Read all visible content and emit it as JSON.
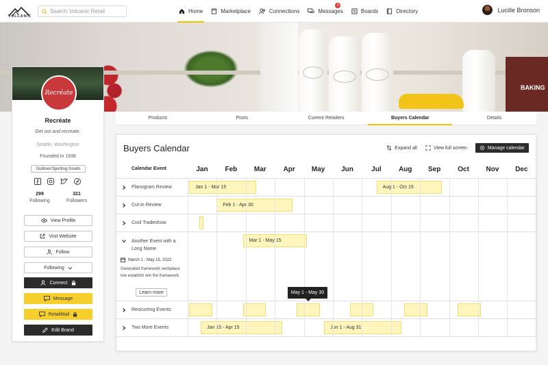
{
  "topnav": {
    "logo_text": "VOLCANIC",
    "search_placeholder": "Search Volcanic Retail",
    "items": [
      {
        "label": "Home",
        "icon": "home-icon",
        "active": true
      },
      {
        "label": "Marketplace",
        "icon": "store-icon",
        "active": false
      },
      {
        "label": "Connections",
        "icon": "people-icon",
        "active": false
      },
      {
        "label": "Messages",
        "icon": "chat-icon",
        "active": false,
        "badge": "5"
      },
      {
        "label": "Boards",
        "icon": "board-icon",
        "active": false
      },
      {
        "label": "Directory",
        "icon": "book-icon",
        "active": false
      }
    ],
    "user_name": "Lucille Bronson"
  },
  "hero": {
    "box_text": "BAKING"
  },
  "profile": {
    "logo_text": "Recréate",
    "name": "Recréate",
    "tagline": "Get out and recreate.",
    "location": "Seattle, Washington",
    "founded": "Founded in 1938",
    "category": "Outdoor/Sporting Goods",
    "socials": [
      "facebook-icon",
      "instagram-icon",
      "twitter-icon",
      "pinterest-icon"
    ],
    "following_count": "299",
    "following_label": "Following",
    "followers_count": "321",
    "followers_label": "Followers",
    "buttons": {
      "view_profile": "View Profile",
      "visit_website": "Visit Website",
      "follow": "Follow",
      "following": "Following",
      "connect": "Connect",
      "message": "Message",
      "retailmail": "RetailMail",
      "edit_brand": "Edit Brand"
    }
  },
  "tabs": [
    {
      "label": "Products",
      "active": false
    },
    {
      "label": "Posts",
      "active": false
    },
    {
      "label": "Current Retailers",
      "active": false
    },
    {
      "label": "Buyers Calendar",
      "active": true
    },
    {
      "label": "Details",
      "active": false
    }
  ],
  "calendar": {
    "title": "Buyers Calendar",
    "expand_all": "Expand all",
    "view_full_screen": "View full screen",
    "manage_calendar": "Manage calendar",
    "column_label": "Calendar Event",
    "months": [
      "Jan",
      "Feb",
      "Mar",
      "Apr",
      "May",
      "Jun",
      "Jul",
      "Aug",
      "Sep",
      "Oct",
      "Nov",
      "Dec"
    ],
    "rows": [
      {
        "name": "Planogram Review",
        "expanded": false,
        "bars": [
          {
            "start": 0.05,
            "end": 2.35,
            "label": "Jan 1 - Mar 15"
          },
          {
            "start": 6.5,
            "end": 8.75,
            "label": "Aug 1 - Oct 15"
          }
        ]
      },
      {
        "name": "Cut-in Review",
        "expanded": false,
        "bars": [
          {
            "start": 1.0,
            "end": 3.6,
            "label": "Feb 1 - Apr 30"
          }
        ]
      },
      {
        "name": "Cool Tradeshow",
        "expanded": false,
        "bars": [
          {
            "start": 0.4,
            "end": 0.55,
            "label": ""
          }
        ]
      },
      {
        "name": "Another Event with a Long Name",
        "expanded": true,
        "bars": [
          {
            "start": 1.9,
            "end": 4.1,
            "label": "Mar 1 - May 15"
          }
        ]
      },
      {
        "name": "Reocurring Events",
        "expanded": false,
        "bars": [
          {
            "start": 0.05,
            "end": 0.85,
            "label": ""
          },
          {
            "start": 1.9,
            "end": 2.7,
            "label": ""
          },
          {
            "start": 3.75,
            "end": 4.55,
            "label": ""
          },
          {
            "start": 5.6,
            "end": 6.4,
            "label": ""
          },
          {
            "start": 7.45,
            "end": 8.25,
            "label": ""
          },
          {
            "start": 9.3,
            "end": 10.1,
            "label": ""
          }
        ]
      },
      {
        "name": "Two More Events",
        "expanded": false,
        "bars": [
          {
            "start": 0.45,
            "end": 3.25,
            "label": "Jan 15 - Apr 15"
          },
          {
            "start": 4.7,
            "end": 7.35,
            "label": "Jun 1 - Aug 31"
          }
        ]
      }
    ],
    "expanded_detail": {
      "date": "March 1 - May 15, 2022",
      "description": "Generated framework workplace low establish win the framework.",
      "learn_more": "Learn more"
    },
    "tooltip": "May 1 - May 30"
  }
}
